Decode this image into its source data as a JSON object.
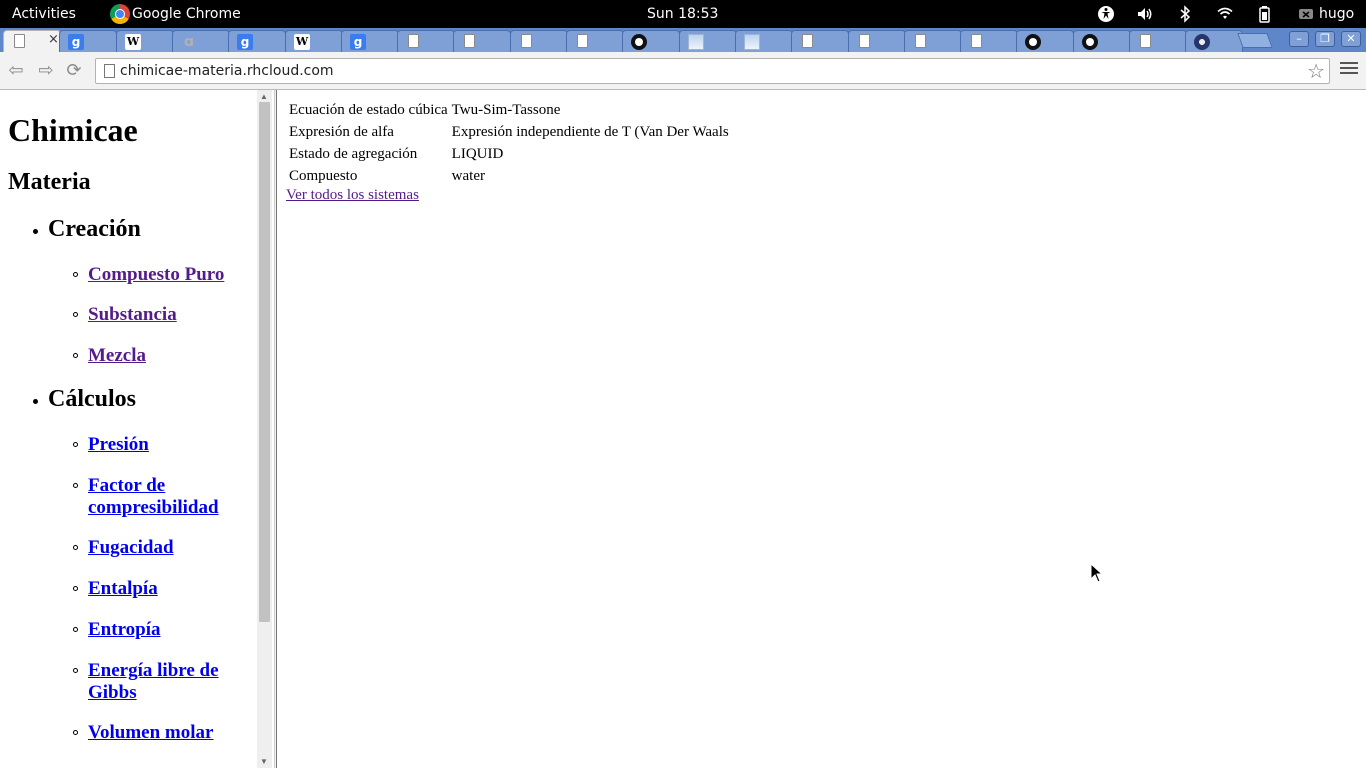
{
  "system": {
    "activities": "Activities",
    "app_name": "Google Chrome",
    "clock": "Sun 18:53",
    "user": "hugo"
  },
  "browser": {
    "tabs": [
      {
        "icon": "page-icon",
        "active": true
      },
      {
        "icon": "google-icon",
        "label": "g"
      },
      {
        "icon": "wikipedia-icon",
        "label": "W"
      },
      {
        "icon": "quill-icon",
        "label": "ɑ"
      },
      {
        "icon": "google-icon",
        "label": "g"
      },
      {
        "icon": "wikipedia-icon",
        "label": "W"
      },
      {
        "icon": "google-icon",
        "label": "g"
      },
      {
        "icon": "page-icon"
      },
      {
        "icon": "page-icon"
      },
      {
        "icon": "page-icon"
      },
      {
        "icon": "page-icon"
      },
      {
        "icon": "github-icon"
      },
      {
        "icon": "image-icon"
      },
      {
        "icon": "image-icon"
      },
      {
        "icon": "page-icon"
      },
      {
        "icon": "page-icon"
      },
      {
        "icon": "page-icon"
      },
      {
        "icon": "page-icon"
      },
      {
        "icon": "github-icon"
      },
      {
        "icon": "github-icon"
      },
      {
        "icon": "page-icon"
      },
      {
        "icon": "dark-circle-icon"
      }
    ],
    "tab_close": "×",
    "url": "chimicae-materia.rhcloud.com"
  },
  "sidebar": {
    "site_title": "Chimicae",
    "section_title": "Materia",
    "groups": [
      {
        "title": "Creación",
        "links": [
          {
            "label": "Compuesto Puro",
            "visited": true
          },
          {
            "label": "Substancia",
            "visited": true
          },
          {
            "label": "Mezcla",
            "visited": true
          }
        ]
      },
      {
        "title": "Cálculos",
        "links": [
          {
            "label": "Presión",
            "visited": false
          },
          {
            "label": "Factor de compresibilidad",
            "visited": false
          },
          {
            "label": "Fugacidad",
            "visited": false
          },
          {
            "label": "Entalpía",
            "visited": false
          },
          {
            "label": "Entropía",
            "visited": false
          },
          {
            "label": "Energía libre de Gibbs",
            "visited": false
          },
          {
            "label": "Volumen molar",
            "visited": false
          }
        ]
      }
    ]
  },
  "main": {
    "properties": [
      {
        "key": "Ecuación de estado cúbica",
        "value": "Twu-Sim-Tassone"
      },
      {
        "key": "Expresión de alfa",
        "value": "Expresión independiente de T (Van Der Waals"
      },
      {
        "key": "Estado de agregación",
        "value": "LIQUID"
      },
      {
        "key": "Compuesto",
        "value": "water"
      }
    ],
    "all_systems_link": "Ver todos los sistemas"
  },
  "colors": {
    "visited_link": "#551a8b",
    "unvisited_link": "#0000ee",
    "tabstrip": "#5f86c9"
  }
}
